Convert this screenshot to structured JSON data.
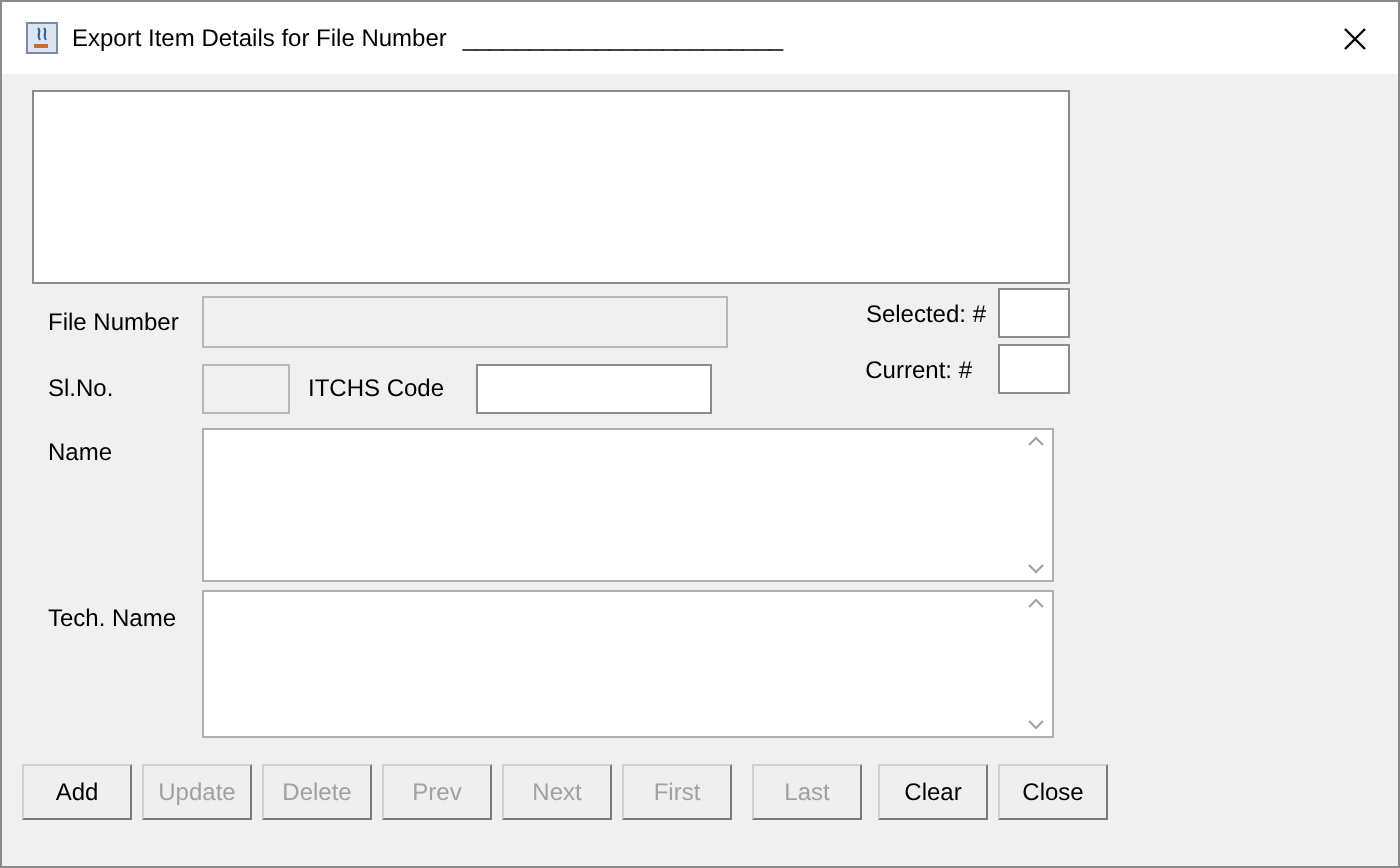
{
  "window": {
    "title": "Export Item Details for File Number",
    "title_blank": "________________________"
  },
  "fields": {
    "file_number": {
      "label": "File Number",
      "disabled": true
    },
    "sl_no": {
      "label": "Sl.No.",
      "disabled": true
    },
    "itchs_code": {
      "label": "ITCHS Code",
      "disabled": false
    },
    "selected": {
      "label": "Selected: #"
    },
    "current": {
      "label": "Current: #"
    },
    "name": {
      "label": "Name"
    },
    "tech_name": {
      "label": "Tech. Name"
    }
  },
  "buttons": [
    {
      "label": "Add",
      "disabled": false
    },
    {
      "label": "Update",
      "disabled": true
    },
    {
      "label": "Delete",
      "disabled": true
    },
    {
      "label": "Prev",
      "disabled": true
    },
    {
      "label": "Next",
      "disabled": true
    },
    {
      "label": "First",
      "disabled": true
    },
    {
      "label": "Last",
      "disabled": true
    },
    {
      "label": "Clear",
      "disabled": false
    },
    {
      "label": "Close",
      "disabled": false
    }
  ]
}
